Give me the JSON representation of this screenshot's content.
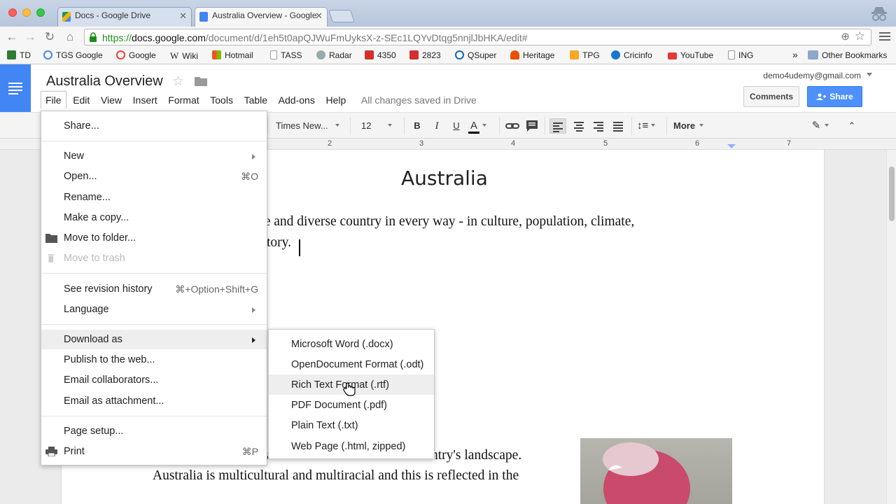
{
  "browser": {
    "tabs": [
      {
        "title": "Docs - Google Drive",
        "active": false
      },
      {
        "title": "Australia Overview - Google",
        "active": true
      }
    ],
    "url": {
      "scheme": "https://",
      "host": "docs.google.com",
      "path": "/document/d/1eh5t0apQJWuFmUyksX-z-SEc1LQYvDtqg5nnjlJbHKA/edit#"
    },
    "bookmarks": [
      "TD",
      "TGS Google",
      "Google",
      "Wiki",
      "Hotmail",
      "TASS",
      "Radar",
      "4350",
      "2823",
      "QSuper",
      "Heritage",
      "TPG",
      "Cricinfo",
      "YouTube",
      "ING"
    ],
    "overflow": "»",
    "other_bookmarks": "Other Bookmarks"
  },
  "docs": {
    "title": "Australia Overview",
    "account": "demo4udemy@gmail.com",
    "menu": [
      "File",
      "Edit",
      "View",
      "Insert",
      "Format",
      "Tools",
      "Table",
      "Add-ons",
      "Help"
    ],
    "save_status": "All changes saved in Drive",
    "comments_label": "Comments",
    "share_label": "Share"
  },
  "toolbar": {
    "font": "Times New...",
    "size": "12",
    "bold": "B",
    "italic": "I",
    "underline": "U",
    "text_color": "A",
    "more": "More"
  },
  "ruler": [
    "2",
    "3",
    "4",
    "5",
    "6",
    "7"
  ],
  "document": {
    "heading": "Australia",
    "line1": "ue and diverse country in every way - in culture, population, climate,",
    "line2": "tory.",
    "line3": "Australian culture is as broad and varied as the country's landscape.",
    "line4": "Australia is multicultural and multiracial and this is reflected in the"
  },
  "file_menu": [
    {
      "label": "Share...",
      "shortcut": "",
      "submenu": false,
      "disabled": false
    },
    {
      "label": "New",
      "shortcut": "",
      "submenu": true,
      "disabled": false
    },
    {
      "label": "Open...",
      "shortcut": "⌘O",
      "submenu": false,
      "disabled": false
    },
    {
      "label": "Rename...",
      "shortcut": "",
      "submenu": false,
      "disabled": false
    },
    {
      "label": "Make a copy...",
      "shortcut": "",
      "submenu": false,
      "disabled": false
    },
    {
      "label": "Move to folder...",
      "shortcut": "",
      "submenu": false,
      "disabled": false
    },
    {
      "label": "Move to trash",
      "shortcut": "",
      "submenu": false,
      "disabled": true
    },
    {
      "label": "See revision history",
      "shortcut": "⌘+Option+Shift+G",
      "submenu": false,
      "disabled": false
    },
    {
      "label": "Language",
      "shortcut": "",
      "submenu": true,
      "disabled": false
    },
    {
      "label": "Download as",
      "shortcut": "",
      "submenu": true,
      "disabled": false
    },
    {
      "label": "Publish to the web...",
      "shortcut": "",
      "submenu": false,
      "disabled": false
    },
    {
      "label": "Email collaborators...",
      "shortcut": "",
      "submenu": false,
      "disabled": false
    },
    {
      "label": "Email as attachment...",
      "shortcut": "",
      "submenu": false,
      "disabled": false
    },
    {
      "label": "Page setup...",
      "shortcut": "",
      "submenu": false,
      "disabled": false
    },
    {
      "label": "Print",
      "shortcut": "⌘P",
      "submenu": false,
      "disabled": false
    }
  ],
  "download_menu": [
    "Microsoft Word (.docx)",
    "OpenDocument Format (.odt)",
    "Rich Text Format (.rtf)",
    "PDF Document (.pdf)",
    "Plain Text (.txt)",
    "Web Page (.html, zipped)"
  ],
  "colors": {
    "docs_blue": "#4285f4",
    "share_blue": "#4d90fe",
    "url_green": "#1a8f1a"
  }
}
